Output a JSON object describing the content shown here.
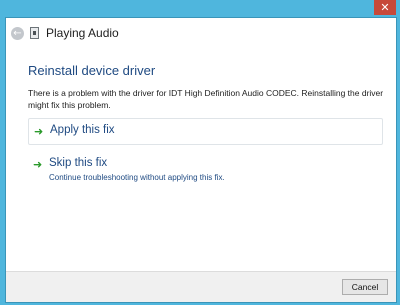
{
  "window": {
    "title": "Playing Audio",
    "close_glyph": "✕"
  },
  "nav": {
    "back_icon": "back-arrow-icon",
    "app_icon": "troubleshooter-icon"
  },
  "content": {
    "heading": "Reinstall device driver",
    "description": "There is a problem with the driver for IDT High Definition Audio CODEC. Reinstalling the driver might fix this problem.",
    "options": [
      {
        "label": "Apply this fix",
        "sub": ""
      },
      {
        "label": "Skip this fix",
        "sub": "Continue troubleshooting without applying this fix."
      }
    ]
  },
  "footer": {
    "cancel_label": "Cancel"
  },
  "colors": {
    "frame": "#4fb6dd",
    "heading": "#1f4a82",
    "arrow": "#2b9a2b",
    "close": "#c7493a"
  }
}
